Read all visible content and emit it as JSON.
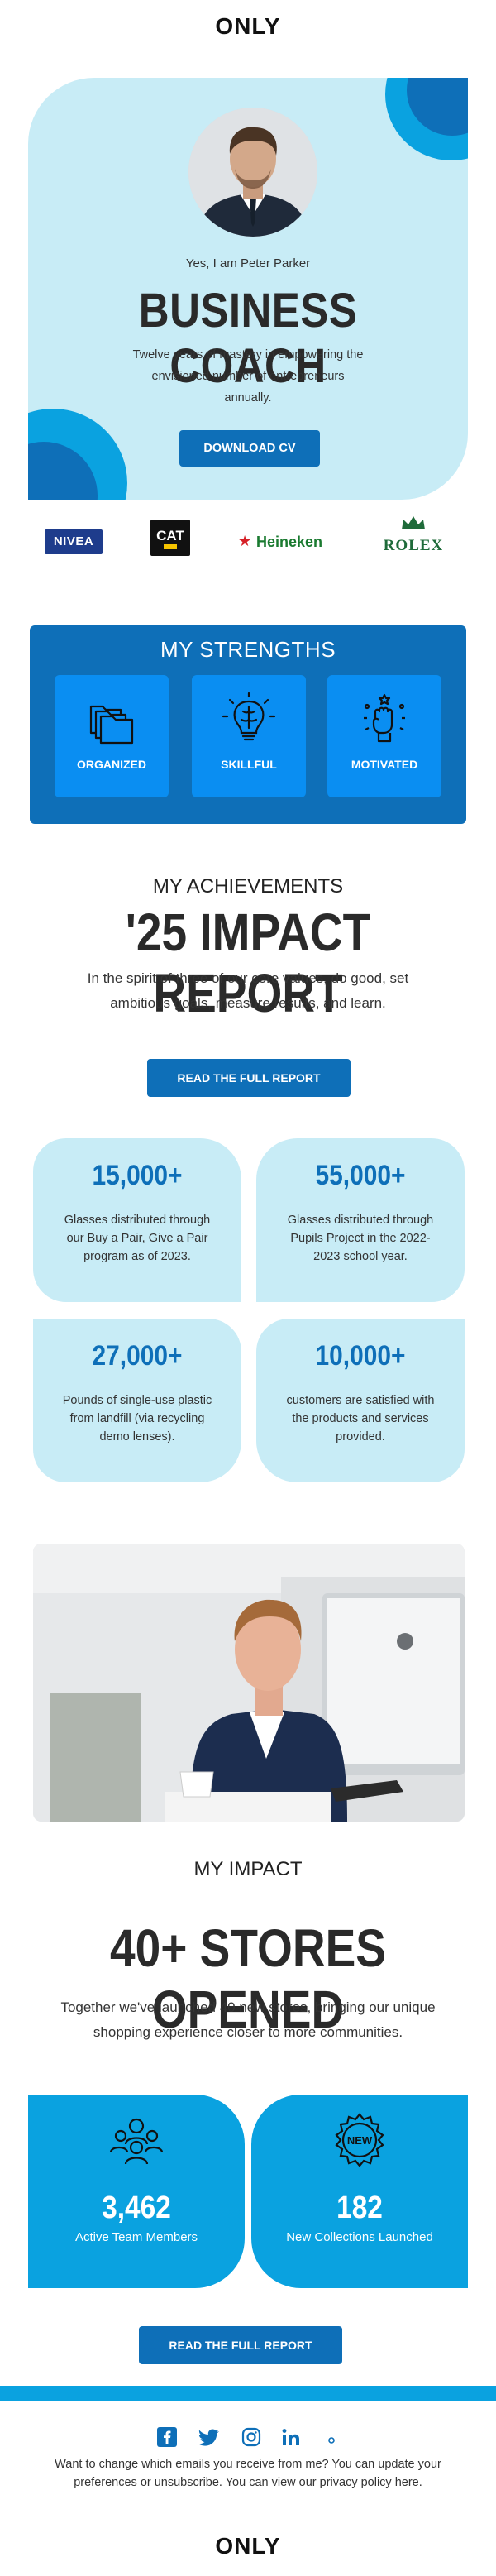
{
  "brand": {
    "logo_top": "ONLY",
    "logo_bottom": "ONLY"
  },
  "hero": {
    "intro": "Yes, I am Peter Parker",
    "title": "BUSINESS COACH",
    "description": "Twelve years of mastery in empowering the envisioned number of entrepreneurs annually.",
    "cta": "DOWNLOAD CV"
  },
  "partners": [
    "NIVEA",
    "CAT",
    "Heineken",
    "ROLEX"
  ],
  "strengths": {
    "heading": "MY STRENGTHS",
    "items": [
      {
        "label": "ORGANIZED",
        "icon": "folders-icon"
      },
      {
        "label": "SKILLFUL",
        "icon": "lightbulb-brain-icon"
      },
      {
        "label": "MOTIVATED",
        "icon": "raised-fist-icon"
      }
    ]
  },
  "achievements": {
    "subheading": "MY ACHIEVEMENTS",
    "title": "'25 IMPACT REPORT",
    "description": "In the spirit of three of our core values, do good, set ambitious goals, measure results, and learn.",
    "cta": "READ THE FULL REPORT",
    "stats": [
      {
        "value": "15,000+",
        "text": "Glasses distributed through our Buy a Pair, Give a Pair program as of 2023."
      },
      {
        "value": "55,000+",
        "text": "Glasses distributed through Pupils Project in the 2022-2023 school year."
      },
      {
        "value": "27,000+",
        "text": "Pounds of single-use plastic from landfill (via recycling demo lenses)."
      },
      {
        "value": "10,000+",
        "text": "customers are satisfied with the products and services provided."
      }
    ]
  },
  "impact": {
    "subheading": "MY IMPACT",
    "title": "40+ STORES OPENED",
    "description": "Together we've launched 40 new stores, bringing our unique shopping experience closer to more communities.",
    "cards": [
      {
        "value": "3,462",
        "label": "Active Team Members",
        "icon": "team-icon"
      },
      {
        "value": "182",
        "label": "New Collections Launched",
        "icon": "new-badge-icon",
        "badge": "NEW"
      }
    ],
    "cta": "READ THE FULL REPORT"
  },
  "footer": {
    "social": [
      "facebook-icon",
      "twitter-icon",
      "instagram-icon",
      "linkedin-icon",
      "dot-icon"
    ],
    "text": "Want to change which emails you receive from me? You can update your preferences or unsubscribe. You can view our privacy policy here."
  },
  "colors": {
    "primary": "#0e6fb8",
    "accent": "#0aa2e0",
    "light": "#c8ecf6"
  }
}
